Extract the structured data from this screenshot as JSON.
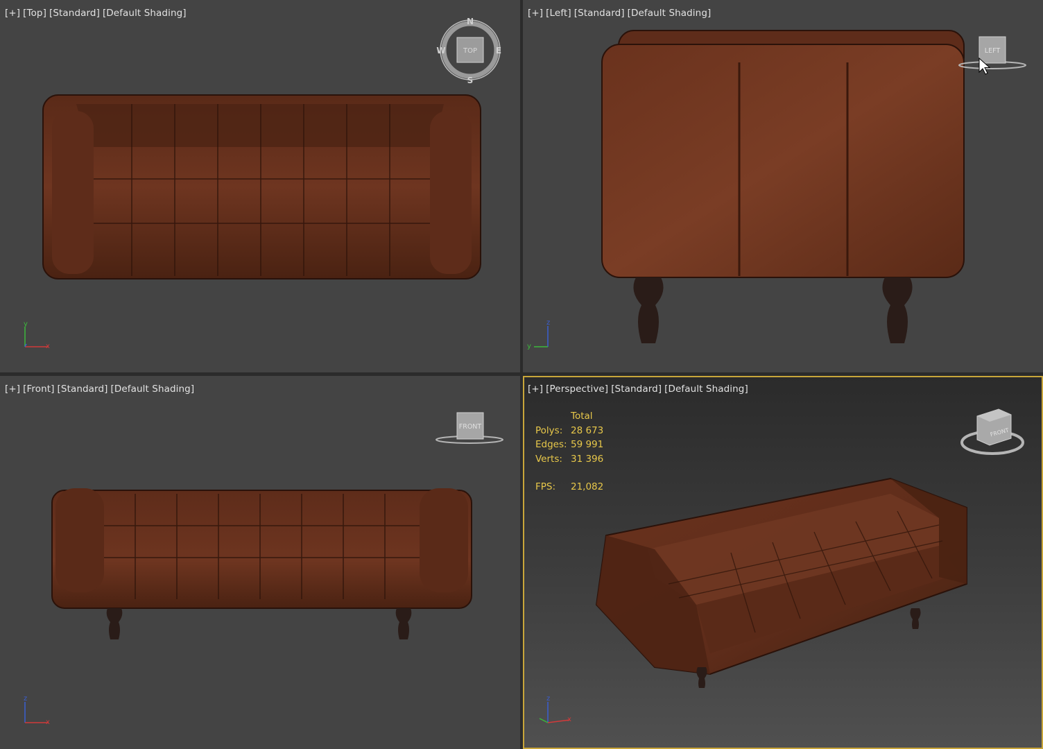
{
  "viewports": {
    "top": {
      "label_parts": [
        "[+]",
        "[Top]",
        "[Standard]",
        "[Default Shading]"
      ],
      "viewcube_label": "TOP",
      "compass": {
        "n": "N",
        "s": "S",
        "e": "E",
        "w": "W"
      },
      "axes": {
        "up": "y",
        "right": "x"
      }
    },
    "left": {
      "label_parts": [
        "[+]",
        "[Left]",
        "[Standard]",
        "[Default Shading]"
      ],
      "viewcube_label": "LEFT",
      "axes": {
        "up": "z",
        "right": "y"
      }
    },
    "front": {
      "label_parts": [
        "[+]",
        "[Front]",
        "[Standard]",
        "[Default Shading]"
      ],
      "viewcube_label": "FRONT",
      "axes": {
        "up": "z",
        "right": "x"
      }
    },
    "perspective": {
      "label_parts": [
        "[+]",
        "[Perspective]",
        "[Standard]",
        "[Default Shading]"
      ],
      "viewcube_label": "FRONT",
      "stats": {
        "header": "Total",
        "polys_label": "Polys:",
        "polys": "28 673",
        "edges_label": "Edges:",
        "edges": "59 991",
        "verts_label": "Verts:",
        "verts": "31 396",
        "fps_label": "FPS:",
        "fps": "21,082"
      },
      "active": true,
      "axes": {
        "up": "z",
        "right": "x"
      }
    }
  },
  "colors": {
    "viewport_bg": "#444444",
    "active_border": "#c9a63a",
    "stats_text": "#e8c84a",
    "leather": "#6b3520",
    "leather_dark": "#3d1a0e",
    "legs": "#2a1c18"
  }
}
